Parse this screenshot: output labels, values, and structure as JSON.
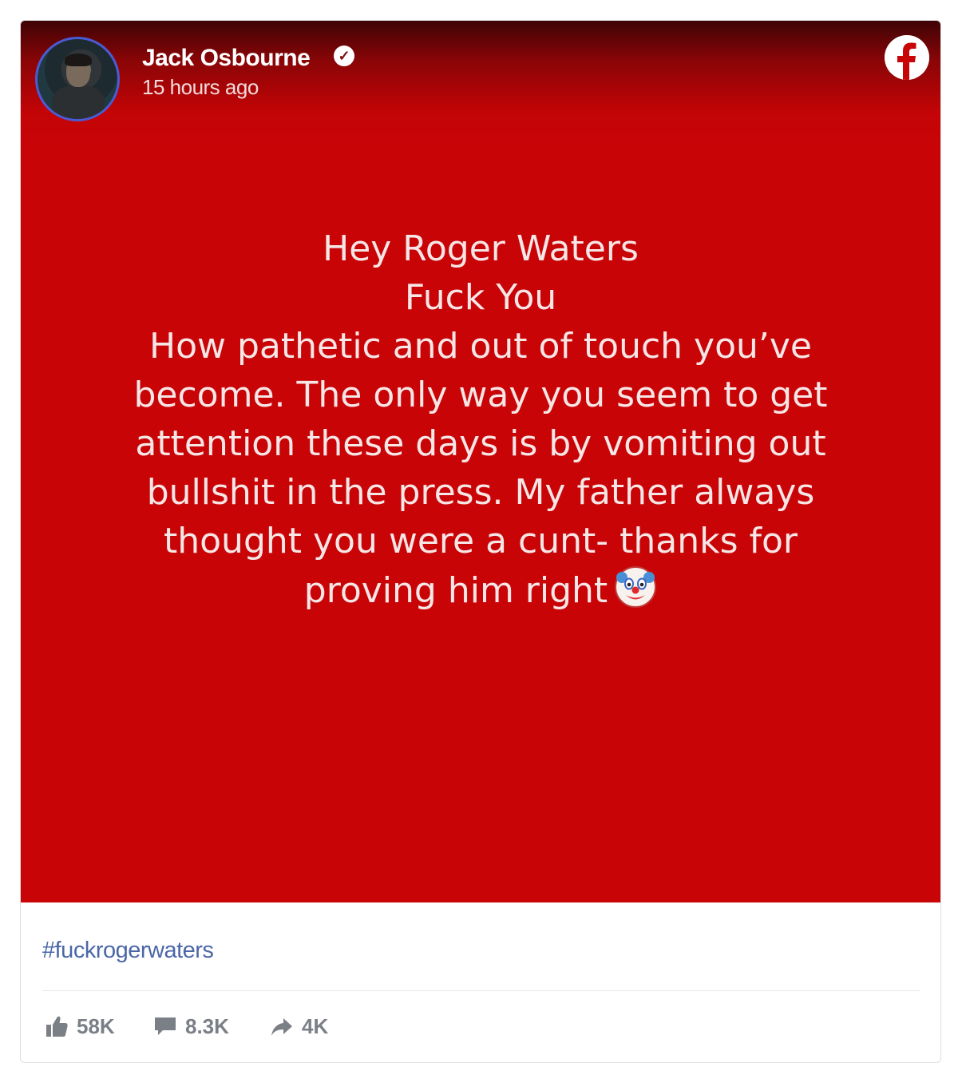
{
  "post": {
    "author": "Jack Osbourne",
    "verified_icon": "verified-check-icon",
    "timestamp": "15 hours ago",
    "platform_icon": "facebook-logo-icon",
    "background_color": "#c90407",
    "status_text": "Hey Roger Waters\nFuck You\nHow pathetic and out of touch you’ve\nbecome. The only way you seem to get\nattention these days is by vomiting out\nbullshit in the press. My father always\nthought you were a cunt- thanks for\nproving him right",
    "status_emoji_icon": "clown-face-icon",
    "hashtag": "#fuckrogerwaters"
  },
  "stats": {
    "likes": "58K",
    "comments": "8.3K",
    "shares": "4K",
    "like_icon": "thumbs-up-icon",
    "comment_icon": "comment-bubble-icon",
    "share_icon": "share-arrow-icon"
  },
  "colors": {
    "hashtag": "#4b67a8",
    "stat_text": "#7b7f86",
    "avatar_ring": "#4a5bd4"
  }
}
